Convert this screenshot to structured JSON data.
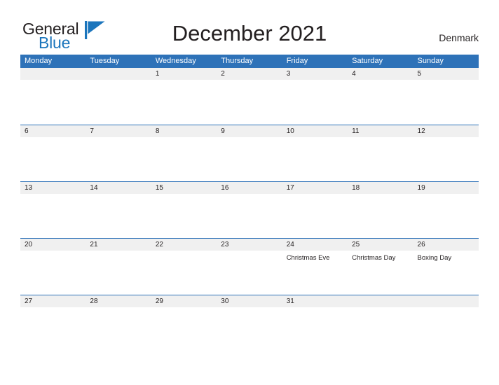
{
  "logo": {
    "word_one": "General",
    "word_two": "Blue",
    "flag_icon": "blue-triangle-flag-icon",
    "color_dark": "#231f20",
    "color_blue": "#1b75bc"
  },
  "header": {
    "title": "December 2021",
    "country": "Denmark"
  },
  "theme": {
    "header_blue": "#2e72b8",
    "band_gray": "#f0f0f0",
    "text_dark": "#231f20",
    "header_text": "#ffffff"
  },
  "calendar": {
    "weekdays": [
      "Monday",
      "Tuesday",
      "Wednesday",
      "Thursday",
      "Friday",
      "Saturday",
      "Sunday"
    ],
    "weeks": [
      [
        {
          "day": "",
          "event": ""
        },
        {
          "day": "",
          "event": ""
        },
        {
          "day": "1",
          "event": ""
        },
        {
          "day": "2",
          "event": ""
        },
        {
          "day": "3",
          "event": ""
        },
        {
          "day": "4",
          "event": ""
        },
        {
          "day": "5",
          "event": ""
        }
      ],
      [
        {
          "day": "6",
          "event": ""
        },
        {
          "day": "7",
          "event": ""
        },
        {
          "day": "8",
          "event": ""
        },
        {
          "day": "9",
          "event": ""
        },
        {
          "day": "10",
          "event": ""
        },
        {
          "day": "11",
          "event": ""
        },
        {
          "day": "12",
          "event": ""
        }
      ],
      [
        {
          "day": "13",
          "event": ""
        },
        {
          "day": "14",
          "event": ""
        },
        {
          "day": "15",
          "event": ""
        },
        {
          "day": "16",
          "event": ""
        },
        {
          "day": "17",
          "event": ""
        },
        {
          "day": "18",
          "event": ""
        },
        {
          "day": "19",
          "event": ""
        }
      ],
      [
        {
          "day": "20",
          "event": ""
        },
        {
          "day": "21",
          "event": ""
        },
        {
          "day": "22",
          "event": ""
        },
        {
          "day": "23",
          "event": ""
        },
        {
          "day": "24",
          "event": "Christmas Eve"
        },
        {
          "day": "25",
          "event": "Christmas Day"
        },
        {
          "day": "26",
          "event": "Boxing Day"
        }
      ],
      [
        {
          "day": "27",
          "event": ""
        },
        {
          "day": "28",
          "event": ""
        },
        {
          "day": "29",
          "event": ""
        },
        {
          "day": "30",
          "event": ""
        },
        {
          "day": "31",
          "event": ""
        },
        {
          "day": "",
          "event": ""
        },
        {
          "day": "",
          "event": ""
        }
      ]
    ]
  }
}
